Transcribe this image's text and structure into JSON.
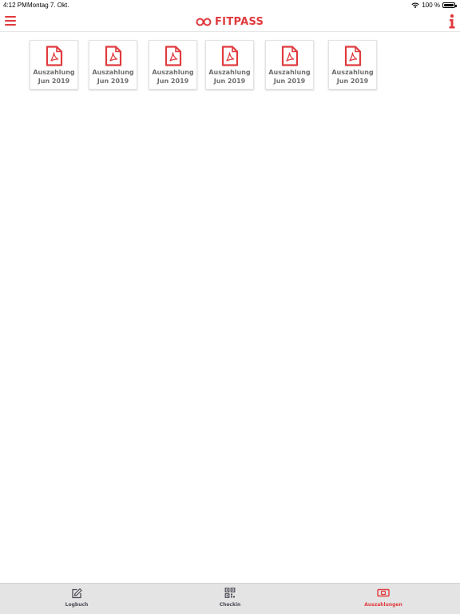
{
  "status_bar": {
    "time": "4:12 PM",
    "date": "Montag 7. Okt.",
    "battery": "100 %"
  },
  "header": {
    "logo_text": "FITPASS",
    "accent": "#e03a3e"
  },
  "documents": [
    {
      "line1": "Auszahlung",
      "line2": "Jun 2019"
    },
    {
      "line1": "Auszahlung",
      "line2": "Jun 2019"
    },
    {
      "line1": "Auszahlung",
      "line2": "Jun 2019"
    },
    {
      "line1": "Auszahlung",
      "line2": "Jun 2019"
    },
    {
      "line1": "Auszahlung",
      "line2": "Jun 2019"
    },
    {
      "line1": "Auszahlung",
      "line2": "Jun 2019"
    }
  ],
  "tabs": [
    {
      "label": "Logbuch",
      "icon": "edit-icon",
      "active": false
    },
    {
      "label": "Checkin",
      "icon": "qr-code-icon",
      "active": false
    },
    {
      "label": "Auszahlungen",
      "icon": "banknote-icon",
      "active": true
    }
  ]
}
